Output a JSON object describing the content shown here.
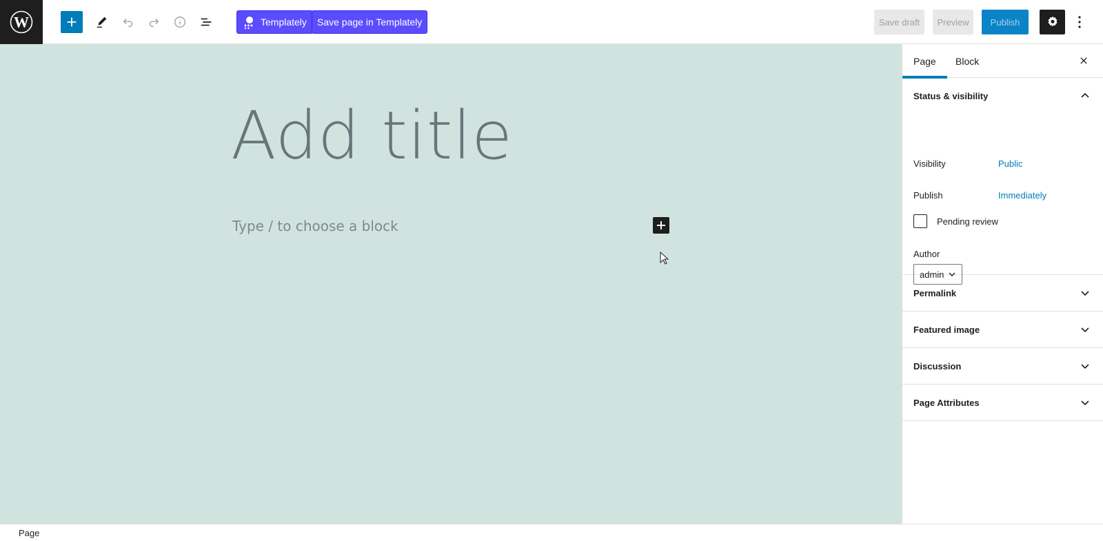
{
  "toolbar": {
    "templately_label": "Templately",
    "templately_save_label": "Save page in Templately",
    "save_draft_label": "Save draft",
    "preview_label": "Preview",
    "publish_label": "Publish",
    "accent_color": "#007cba",
    "templately_color": "#5b4cfe"
  },
  "editor": {
    "title_placeholder": "Add title",
    "block_placeholder": "Type / to choose a block",
    "canvas_color": "#d1e3de"
  },
  "sidebar": {
    "tabs": [
      {
        "label": "Page",
        "active": true
      },
      {
        "label": "Block",
        "active": false
      }
    ],
    "status_panel": {
      "title": "Status & visibility",
      "visibility_label": "Visibility",
      "visibility_value": "Public",
      "publish_label": "Publish",
      "publish_value": "Immediately",
      "pending_review_label": "Pending review",
      "pending_review_checked": false,
      "author_label": "Author",
      "author_value": "admin"
    },
    "panels": [
      {
        "title": "Permalink"
      },
      {
        "title": "Featured image"
      },
      {
        "title": "Discussion"
      },
      {
        "title": "Page Attributes"
      }
    ]
  },
  "statusbar": {
    "breadcrumb": "Page"
  }
}
